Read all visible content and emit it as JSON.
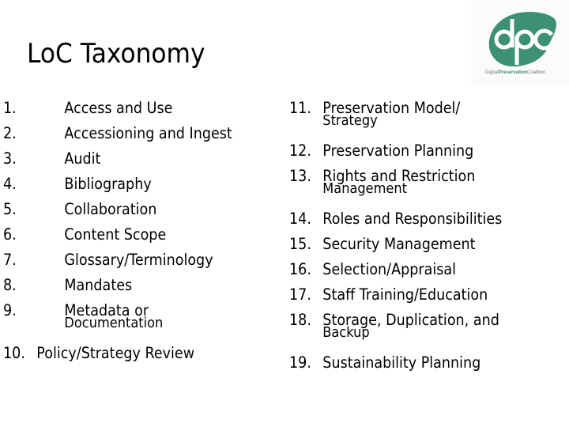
{
  "slide": {
    "title": "LoC Taxonomy",
    "logo": {
      "brand_color": "#3d8f76",
      "text_prefix": "Digital",
      "text_bold": "Preservation",
      "text_suffix": "Coalition"
    },
    "left_list": [
      {
        "num": "1.",
        "lines": [
          "Access and Use"
        ]
      },
      {
        "num": "2.",
        "lines": [
          "Accessioning and Ingest"
        ]
      },
      {
        "num": "3.",
        "lines": [
          "Audit"
        ]
      },
      {
        "num": "4.",
        "lines": [
          "Bibliography"
        ]
      },
      {
        "num": "5.",
        "lines": [
          "Collaboration"
        ]
      },
      {
        "num": "6.",
        "lines": [
          "Content Scope"
        ]
      },
      {
        "num": "7.",
        "lines": [
          "Glossary/Terminology"
        ]
      },
      {
        "num": "8.",
        "lines": [
          "Mandates"
        ]
      },
      {
        "num": "9.",
        "lines": [
          "Metadata or",
          "Documentation"
        ]
      },
      {
        "num": "10.",
        "lines": [
          "Policy/Strategy Review"
        ]
      }
    ],
    "right_list": [
      {
        "num": "11.",
        "lines": [
          "Preservation Model/",
          "Strategy"
        ]
      },
      {
        "num": "12.",
        "lines": [
          "Preservation Planning"
        ]
      },
      {
        "num": "13.",
        "lines": [
          "Rights and Restriction",
          "Management"
        ]
      },
      {
        "num": "14.",
        "lines": [
          "Roles and Responsibilities"
        ]
      },
      {
        "num": "15.",
        "lines": [
          "Security Management"
        ]
      },
      {
        "num": "16.",
        "lines": [
          "Selection/Appraisal"
        ]
      },
      {
        "num": "17.",
        "lines": [
          "Staff Training/Education"
        ]
      },
      {
        "num": "18.",
        "lines": [
          "Storage, Duplication, and",
          "Backup"
        ]
      },
      {
        "num": "19.",
        "lines": [
          "Sustainability Planning"
        ]
      }
    ]
  }
}
